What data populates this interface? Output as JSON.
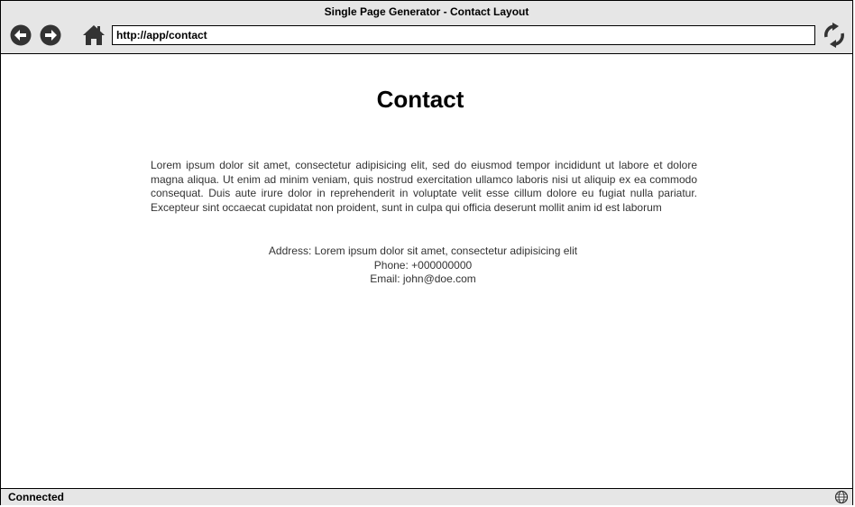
{
  "window": {
    "title": "Single Page Generator - Contact Layout"
  },
  "toolbar": {
    "url": "http://app/contact",
    "icons": [
      "arrow-left-icon",
      "arrow-right-icon",
      "home-icon",
      "refresh-icon"
    ]
  },
  "content": {
    "heading": "Contact",
    "paragraph": "Lorem ipsum dolor sit amet, consectetur adipisicing elit, sed do eiusmod tempor incididunt ut labore et dolore magna aliqua. Ut enim ad minim veniam, quis nostrud exercitation ullamco laboris nisi ut aliquip ex ea commodo consequat. Duis aute irure dolor in reprehenderit in voluptate velit esse cillum dolore eu fugiat nulla pariatur. Excepteur sint occaecat cupidatat non proident, sunt in culpa qui officia deserunt mollit anim id est laborum",
    "address": "Address: Lorem ipsum dolor sit amet, consectetur adipisicing elit",
    "phone": "Phone: +000000000",
    "email": "Email: john@doe.com"
  },
  "statusbar": {
    "status": "Connected",
    "icon": "globe-icon"
  }
}
